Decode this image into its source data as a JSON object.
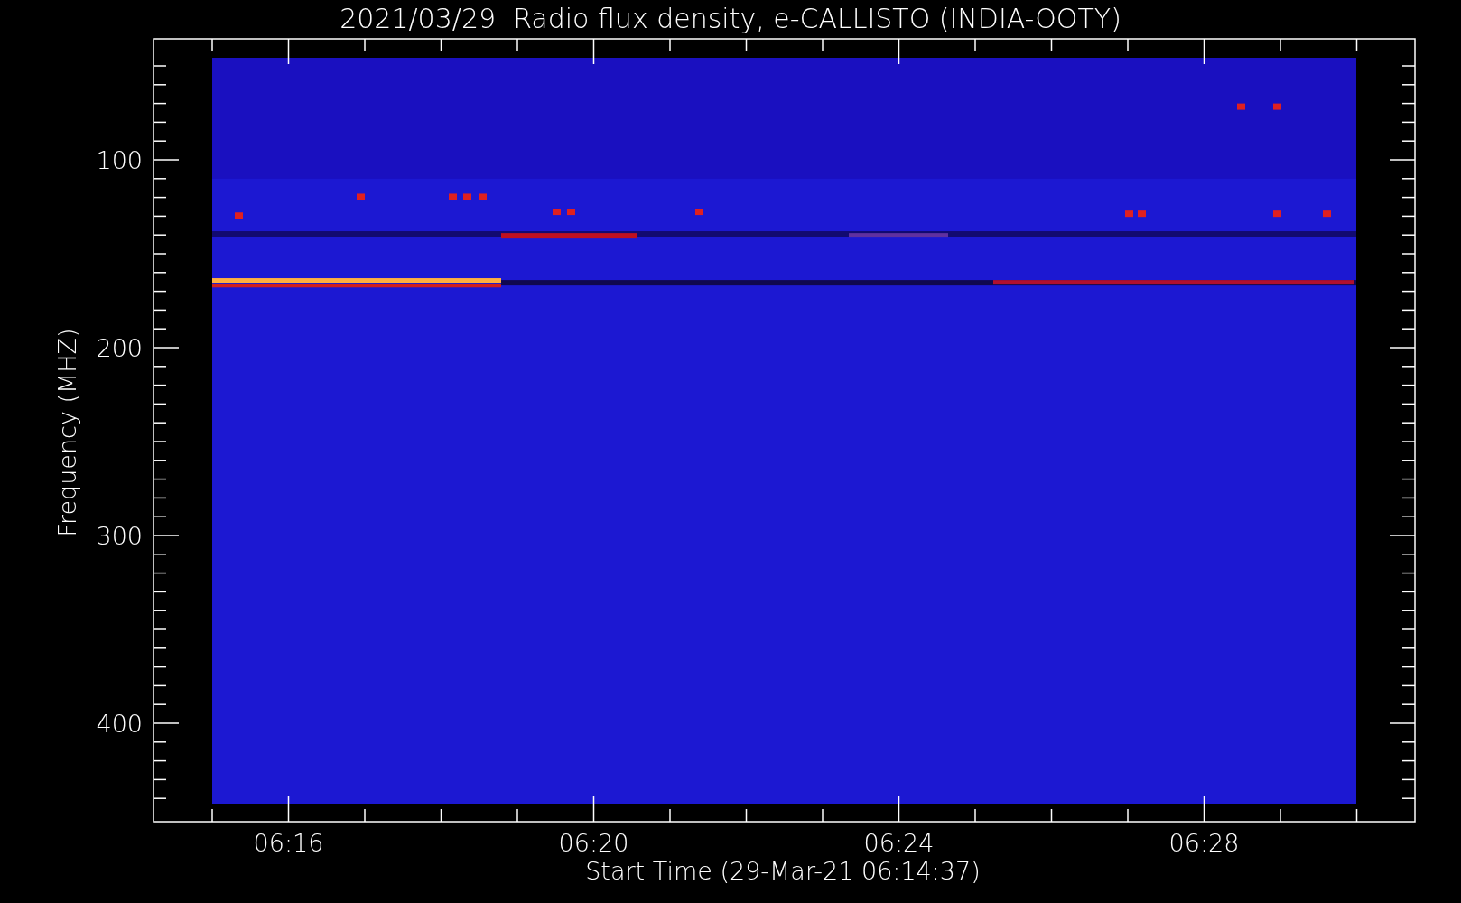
{
  "title": "2021/03/29  Radio flux density, e-CALLISTO (INDIA-OOTY)",
  "y_axis": {
    "label": "Frequency (MHZ)",
    "ticks": [
      "100",
      "200",
      "300",
      "400"
    ]
  },
  "x_axis": {
    "label": "Start Time (29-Mar-21 06:14:37)",
    "ticks": [
      "06:16",
      "06:20",
      "06:24",
      "06:28"
    ]
  }
}
